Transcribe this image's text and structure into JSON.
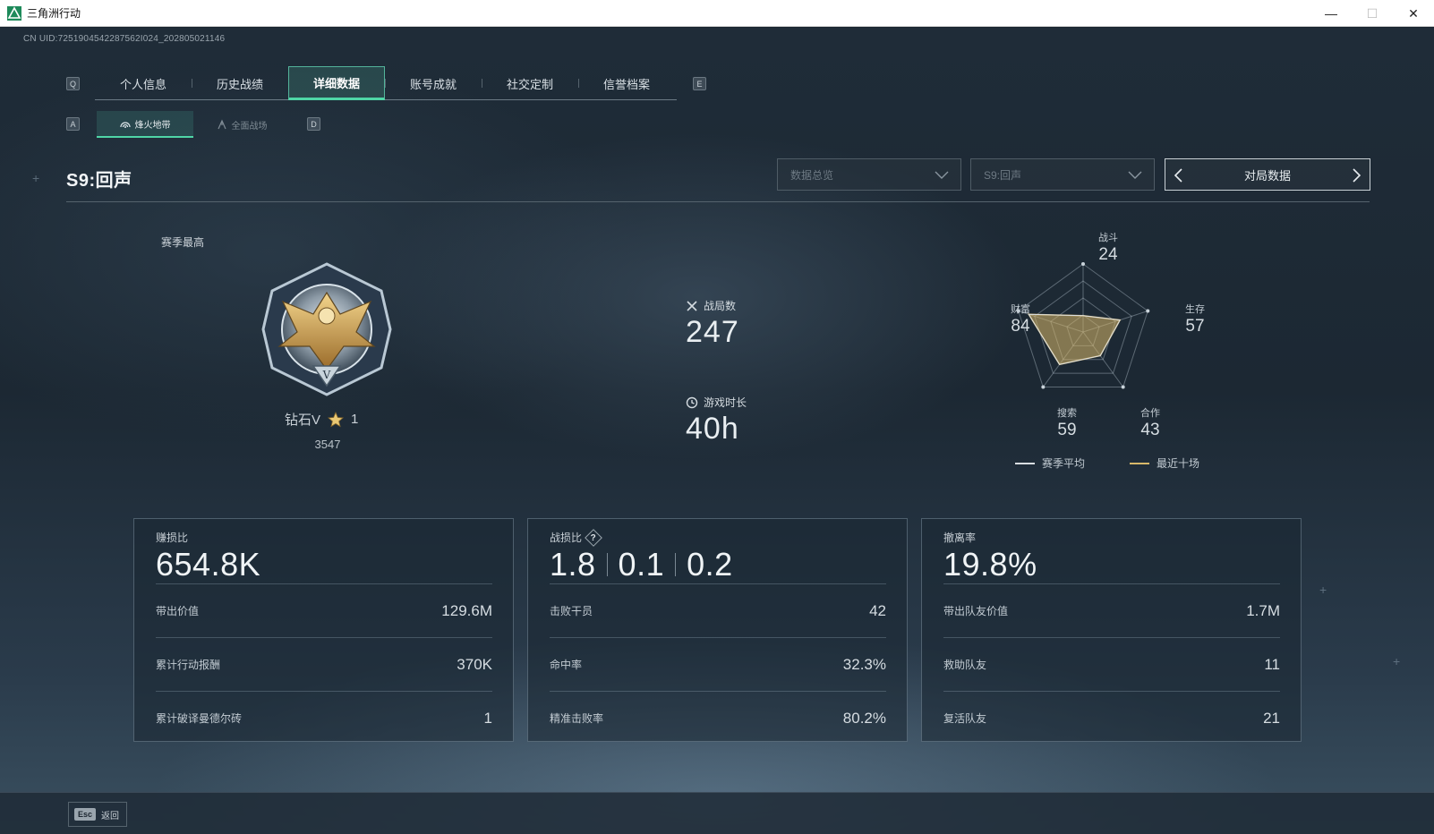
{
  "window": {
    "title": "三角洲行动",
    "minimize": "—",
    "maximize": "☐",
    "close": "✕"
  },
  "uid": "CN UID:7251904542287562I024_202805021146",
  "keys": {
    "tab_prev": "Q",
    "tab_next": "E",
    "sub_prev": "A",
    "sub_next": "D"
  },
  "tabs": [
    {
      "label": "个人信息"
    },
    {
      "label": "历史战绩"
    },
    {
      "label": "详细数据",
      "active": true
    },
    {
      "label": "账号成就"
    },
    {
      "label": "社交定制"
    },
    {
      "label": "信誉档案"
    }
  ],
  "subtabs": [
    {
      "label": "烽火地带",
      "active": true,
      "icon": "radar-icon"
    },
    {
      "label": "全面战场",
      "icon": "flag-icon"
    }
  ],
  "season_title": "S9:回声",
  "filters": {
    "data_type": "数据总览",
    "season": "S9:回声",
    "pager_label": "对局数据"
  },
  "rank": {
    "heading": "赛季最高",
    "tier": "钻石V",
    "stars": "1",
    "score": "3547",
    "medal_mark": "V"
  },
  "stats": {
    "matches_label": "战局数",
    "matches_value": "247",
    "playtime_label": "游戏时长",
    "playtime_value": "40h"
  },
  "radar": {
    "axes": [
      {
        "name": "战斗",
        "value": "24"
      },
      {
        "name": "生存",
        "value": "57"
      },
      {
        "name": "合作",
        "value": "43"
      },
      {
        "name": "搜索",
        "value": "59"
      },
      {
        "name": "财富",
        "value": "84"
      }
    ],
    "legend": {
      "season_avg": "赛季平均",
      "recent10": "最近十场"
    },
    "colors": {
      "season_avg": "#d9dee2",
      "recent10": "#d8b86a"
    }
  },
  "cards": [
    {
      "header": "赚损比",
      "big": "654.8K",
      "rows": [
        {
          "k": "带出价值",
          "v": "129.6M"
        },
        {
          "k": "累计行动报酬",
          "v": "370K"
        },
        {
          "k": "累计破译曼德尔砖",
          "v": "1"
        }
      ]
    },
    {
      "header": "战损比",
      "help": "?",
      "big_parts": [
        "1.8",
        "0.1",
        "0.2"
      ],
      "rows": [
        {
          "k": "击败干员",
          "v": "42"
        },
        {
          "k": "命中率",
          "v": "32.3%"
        },
        {
          "k": "精准击败率",
          "v": "80.2%"
        }
      ]
    },
    {
      "header": "撤离率",
      "big": "19.8%",
      "rows": [
        {
          "k": "带出队友价值",
          "v": "1.7M"
        },
        {
          "k": "救助队友",
          "v": "11"
        },
        {
          "k": "复活队友",
          "v": "21"
        }
      ]
    }
  ],
  "footer": {
    "esc_key": "Esc",
    "back_label": "返回"
  },
  "accent": "#4fd6a6"
}
